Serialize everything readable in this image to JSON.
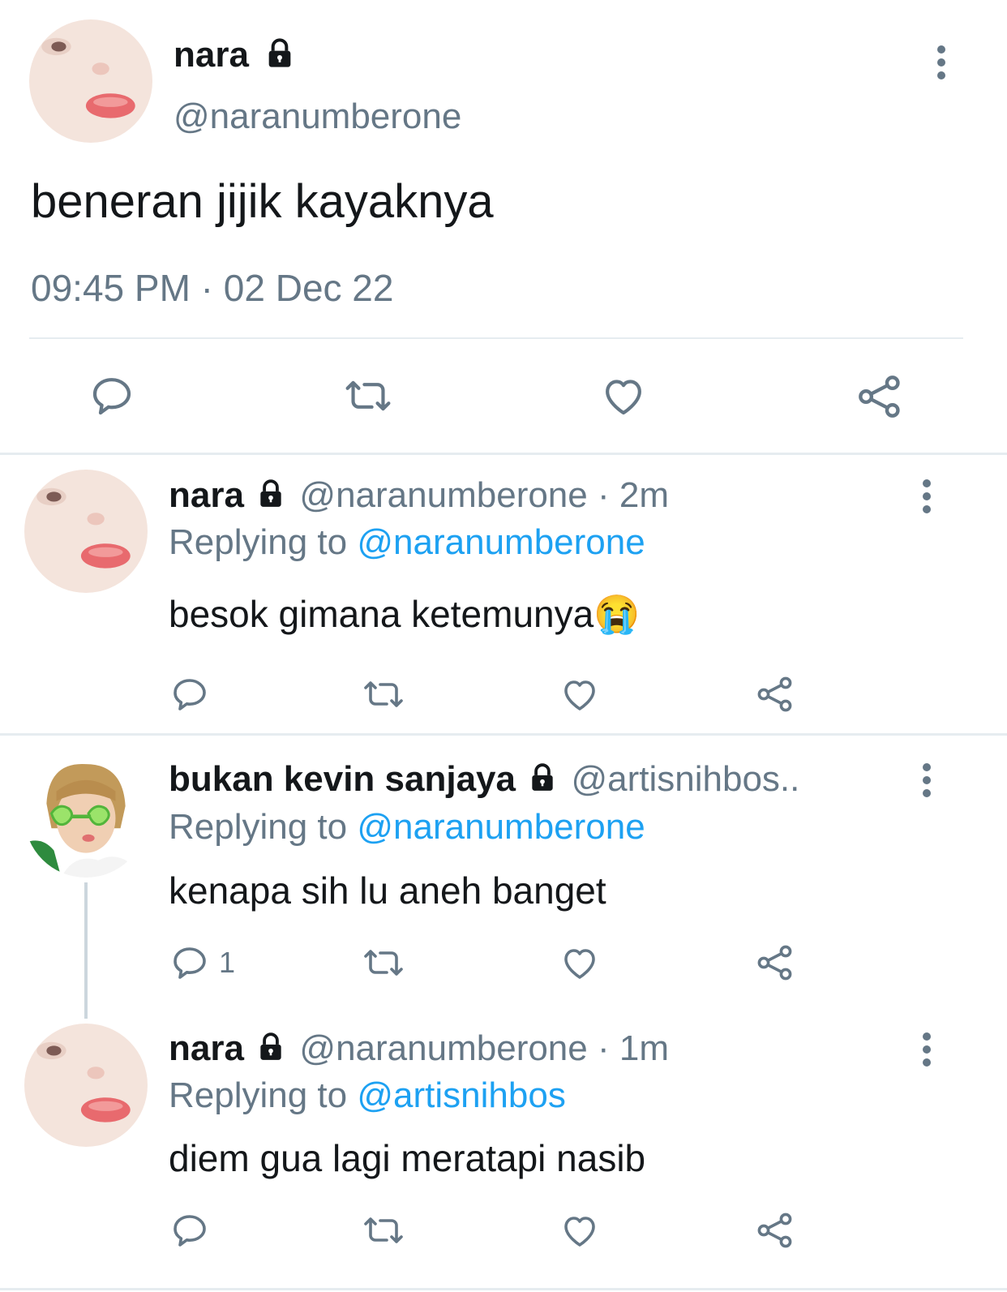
{
  "main_tweet": {
    "name": "nara",
    "handle": "@naranumberone",
    "text": "beneran jijik kayaknya",
    "timestamp": "09:45 PM · 02 Dec 22",
    "avatar_icon": "user-avatar-icon"
  },
  "replies": [
    {
      "name": "nara",
      "handle": "@naranumberone",
      "time": "· 2m",
      "replying_prefix": "Replying to",
      "replying_to": "@naranumberone",
      "text": "besok gimana ketemunya😭",
      "reply_count": ""
    },
    {
      "name": "bukan kevin sanjaya",
      "handle": "@artisnihbos..",
      "time": "",
      "replying_prefix": "Replying to",
      "replying_to": "@naranumberone",
      "text": "kenapa sih lu aneh banget",
      "reply_count": "1"
    },
    {
      "name": "nara",
      "handle": "@naranumberone",
      "time": "· 1m",
      "replying_prefix": "Replying to",
      "replying_to": "@artisnihbos",
      "text": "diem gua lagi meratapi nasib",
      "reply_count": ""
    }
  ],
  "colors": {
    "text": "#14171a",
    "secondary": "#657786",
    "link": "#1da1f2",
    "divider": "#e6ecf0"
  },
  "icons": [
    "lock-icon",
    "more-options-icon",
    "reply-icon",
    "retweet-icon",
    "like-icon",
    "share-icon"
  ]
}
